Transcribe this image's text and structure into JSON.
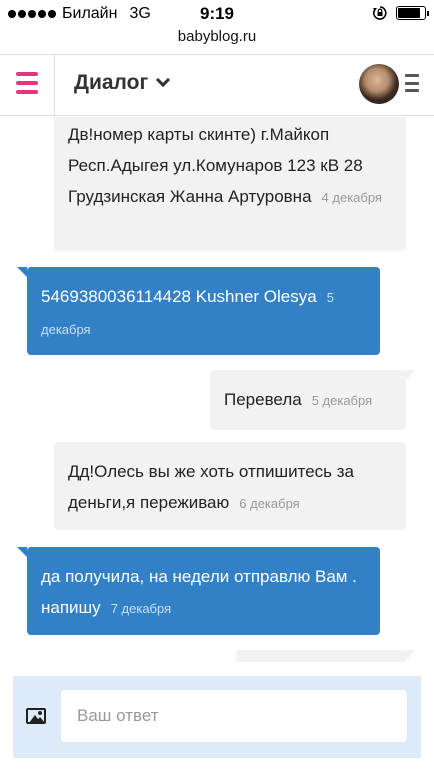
{
  "status_bar": {
    "carrier": "Билайн",
    "network": "3G",
    "time": "9:19"
  },
  "browser": {
    "url": "babyblog.ru"
  },
  "header": {
    "title": "Диалог"
  },
  "messages": [
    {
      "direction": "incoming",
      "text": "Дв!номер карты скинте) г.Майкоп Респ.Адыгея ул.Комунаров 123 кВ 28 Грудзинская Жанна Артуровна",
      "date": "4 декабря"
    },
    {
      "direction": "outgoing",
      "text": "5469380036114428 Kushner Olesya",
      "date": "5 декабря"
    },
    {
      "direction": "incoming",
      "text": "Перевела",
      "date": "5 декабря"
    },
    {
      "direction": "incoming",
      "text": "Дд!Олесь вы же хоть отпишитесь за деньги,я переживаю",
      "date": "6 декабря"
    },
    {
      "direction": "outgoing",
      "text": "да получила, на недели отправлю Вам . напишу",
      "date": "7 декабря"
    }
  ],
  "composer": {
    "placeholder": "Ваш ответ"
  },
  "colors": {
    "accent": "#e8347a",
    "outgoing_bubble": "#3281c6",
    "incoming_bubble": "#f2f2f2",
    "composer_bg": "#dcebf7"
  },
  "icons": [
    "menu-icon",
    "chevron-down-icon",
    "more-menu-icon",
    "image-icon",
    "battery-icon",
    "signal-icon",
    "rotation-lock-icon"
  ]
}
